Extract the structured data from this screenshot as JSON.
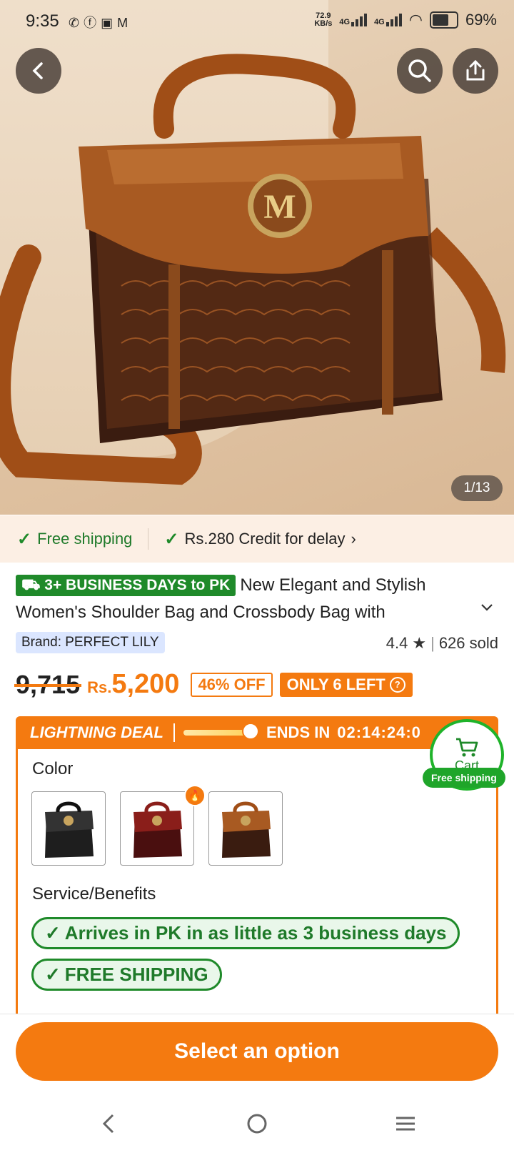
{
  "status_bar": {
    "time": "9:35",
    "net_speed_value": "72.9",
    "net_speed_unit": "KB/s",
    "sim1": "4G",
    "sim2": "4G",
    "battery": "69%"
  },
  "hero": {
    "image_counter": "1/13"
  },
  "shipping_strip": {
    "free_shipping": "Free shipping",
    "credit": "Rs.280 Credit for delay"
  },
  "product": {
    "delivery_badge": "3+ BUSINESS DAYS to PK",
    "title": "New Elegant and Stylish Women's Shoulder Bag and Crossbody Bag with",
    "brand": "Brand: PERFECT LILY",
    "rating": "4.4",
    "sold": "626 sold",
    "old_price": "9,715",
    "currency": "Rs.",
    "price": "5,200",
    "discount": "46% OFF",
    "stock": "ONLY 6 LEFT"
  },
  "deal": {
    "label": "LIGHTNING DEAL",
    "progress_fraction": 0.84,
    "ends_label": "ENDS IN",
    "countdown": "02:14:24:0"
  },
  "cart": {
    "label": "Cart",
    "tag": "Free shipping"
  },
  "options": {
    "color_label": "Color",
    "colors": [
      "black",
      "burgundy",
      "brown"
    ],
    "service_label": "Service/Benefits",
    "benefits": [
      "Arrives in PK in as little as 3 business days",
      "FREE SHIPPING"
    ]
  },
  "cta": {
    "label": "Select an option"
  },
  "colors": {
    "accent": "#f47a10",
    "success": "#1f8a2a"
  }
}
